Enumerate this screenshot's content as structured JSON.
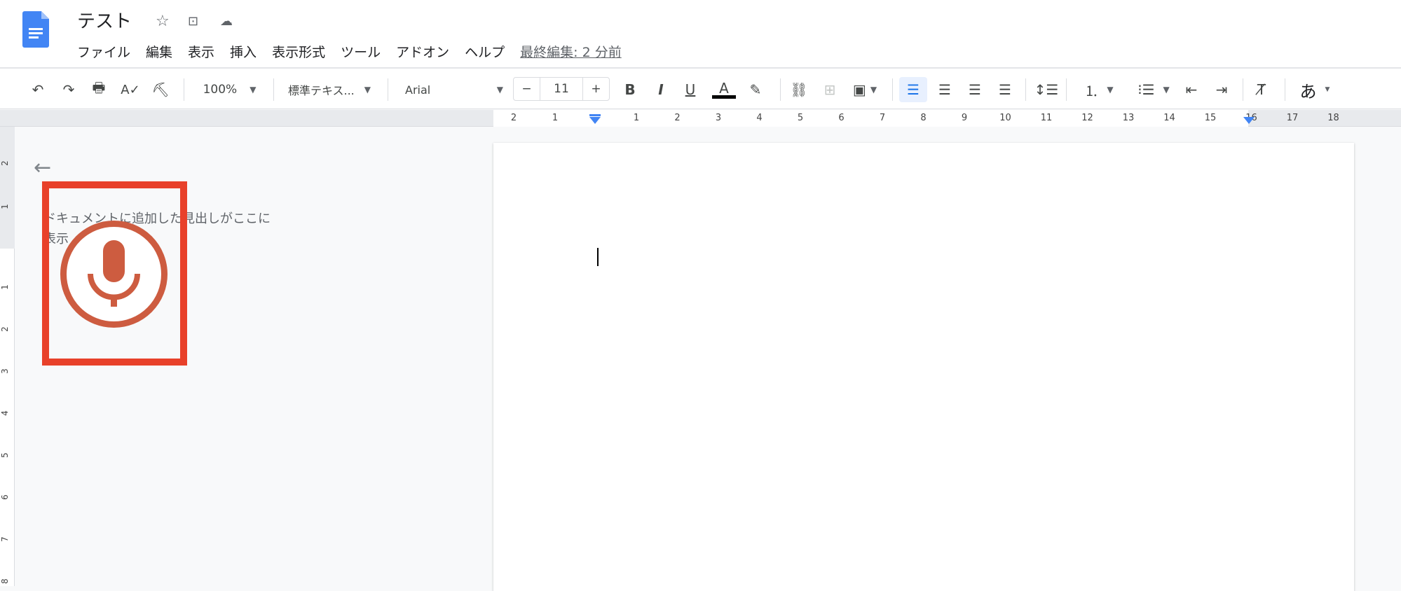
{
  "header": {
    "title": "テスト",
    "icons": [
      "star-icon",
      "move-to-folder-icon",
      "cloud-saved-icon"
    ]
  },
  "menu": {
    "items": [
      "ファイル",
      "編集",
      "表示",
      "挿入",
      "表示形式",
      "ツール",
      "アドオン",
      "ヘルプ"
    ],
    "last_edit": "最終編集: 2 分前"
  },
  "toolbar": {
    "zoom": "100%",
    "style": "標準テキス...",
    "font": "Arial",
    "font_size": "11",
    "minus": "−",
    "plus": "+",
    "bold": "B",
    "italic": "I",
    "underline": "U",
    "text_color": "A",
    "input_tool": "あ"
  },
  "ruler": {
    "top": [
      "2",
      "1",
      "1",
      "2",
      "3",
      "4",
      "5",
      "6",
      "7",
      "8",
      "9",
      "10",
      "11",
      "12",
      "13",
      "14",
      "15",
      "16",
      "17",
      "18"
    ],
    "left": [
      "2",
      "1",
      "1",
      "2",
      "3",
      "4",
      "5",
      "6",
      "7",
      "8"
    ]
  },
  "outline": {
    "hint": "ドキュメントに追加した見出しがここに表示"
  },
  "colors": {
    "accent": "#1a73e8",
    "highlight_box": "#e8412a",
    "mic": "#cd5c40",
    "doc_logo": "#4285f4"
  }
}
